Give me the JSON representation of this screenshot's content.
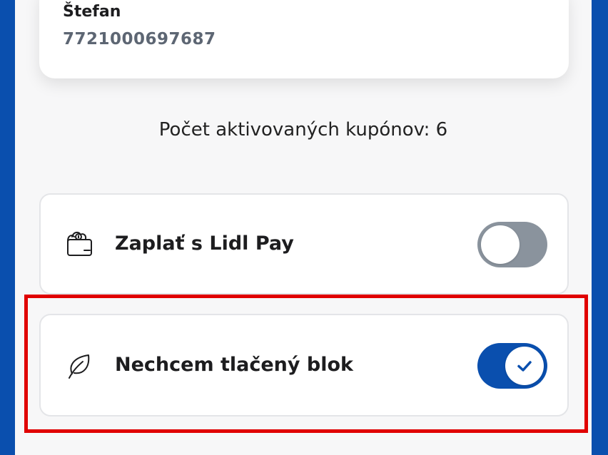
{
  "account": {
    "name": "Štefan",
    "number": "7721000697687"
  },
  "coupons": {
    "count_text": "Počet aktivovaných kupónov: 6"
  },
  "settings": {
    "pay": {
      "icon": "wallet-icon",
      "label": "Zaplať s Lidl Pay",
      "enabled": false
    },
    "receipt": {
      "icon": "leaf-icon",
      "label": "Nechcem tlačený blok",
      "enabled": true
    }
  },
  "colors": {
    "brand_blue": "#0a4fae",
    "toggle_off": "#8a939d",
    "highlight": "#e00000"
  }
}
